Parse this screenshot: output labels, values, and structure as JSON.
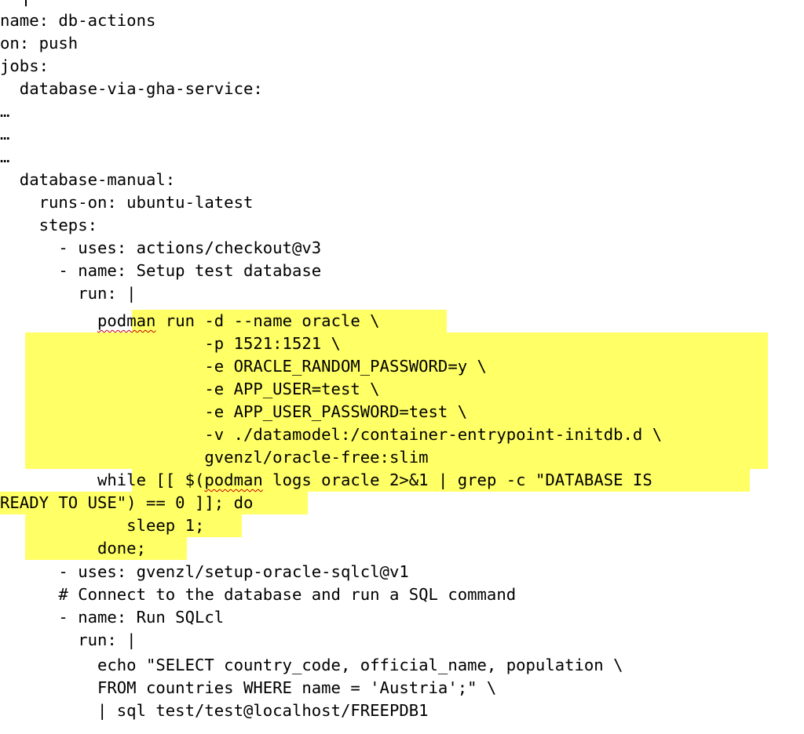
{
  "code_lines": [
    "name: db-actions",
    "on: push",
    "jobs:",
    "  database-via-gha-service:",
    "…",
    "…",
    "…",
    "  database-manual:",
    "    runs-on: ubuntu-latest",
    "    steps:",
    "      - uses: actions/checkout@v3",
    "      - name: Setup test database",
    "        run: |",
    "          podman run -d --name oracle \\",
    "                     -p 1521:1521 \\",
    "                     -e ORACLE_RANDOM_PASSWORD=y \\",
    "                     -e APP_USER=test \\",
    "                     -e APP_USER_PASSWORD=test \\",
    "                     -v ./datamodel:/container-entrypoint-initdb.d \\",
    "                     gvenzl/oracle-free:slim",
    "          while [[ $(podman logs oracle 2>&1 | grep -c \"DATABASE IS",
    "READY TO USE\") == 0 ]]; do",
    "             sleep 1;",
    "          done;",
    "      - uses: gvenzl/setup-oracle-sqlcl@v1",
    "      # Connect to the database and run a SQL command",
    "      - name: Run SQLcl",
    "        run: |",
    "          echo \"SELECT country_code, official_name, population \\",
    "          FROM countries WHERE name = 'Austria';\" \\",
    "          | sql test/test@localhost/FREEPDB1"
  ],
  "highlight_color": "#ffff66",
  "spellcheck_word": "podman"
}
